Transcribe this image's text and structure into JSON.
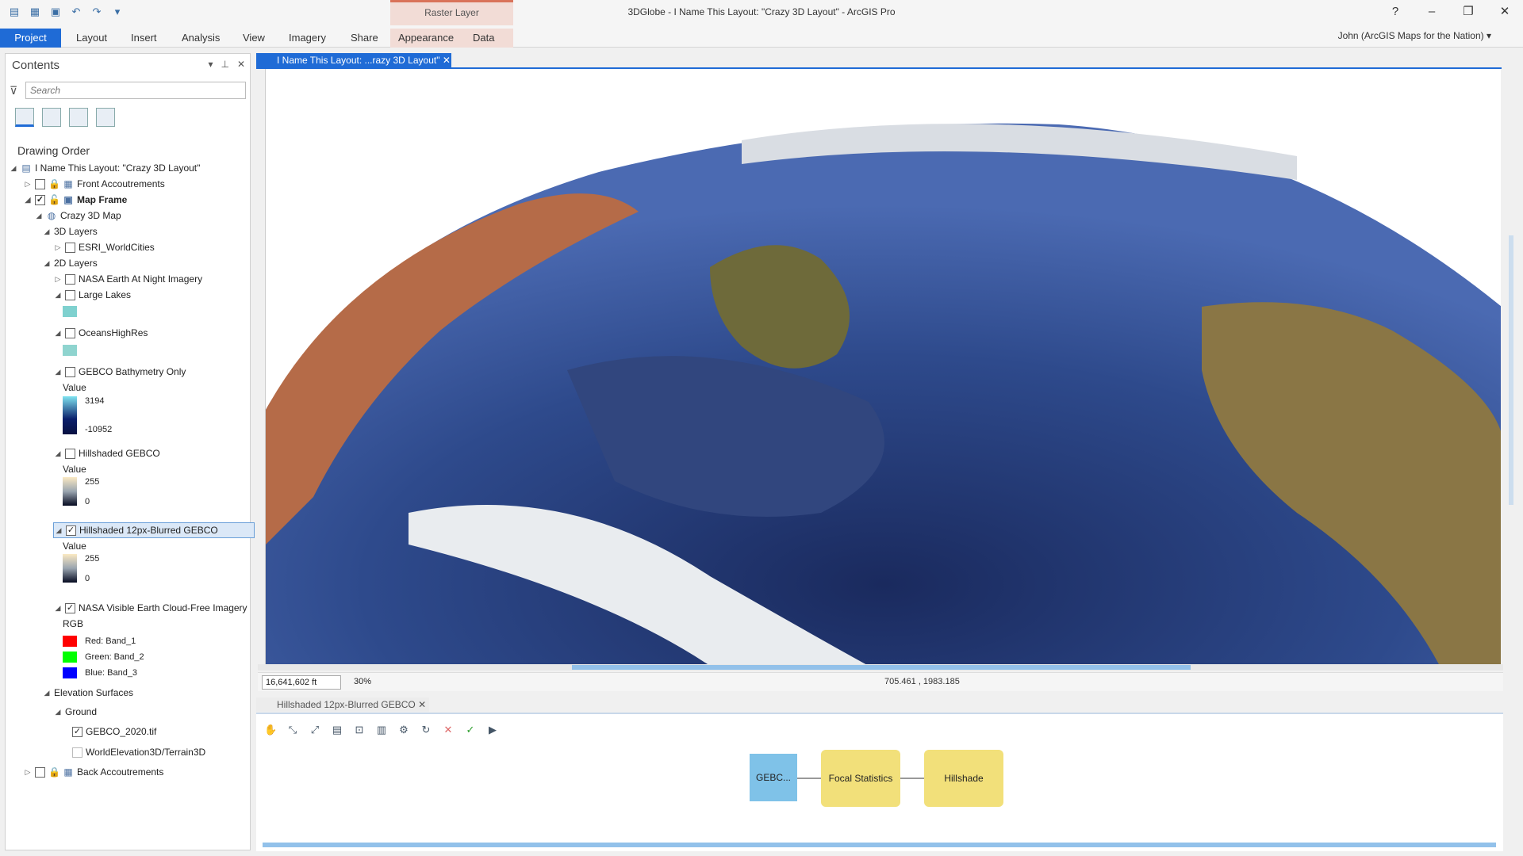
{
  "window": {
    "title": "3DGlobe - I Name This Layout: \"Crazy 3D Layout\" - ArcGIS Pro",
    "context_tab_group": "Raster Layer",
    "help": "?",
    "minimize": "–",
    "restore": "❐",
    "close": "✕"
  },
  "ribbon": {
    "tabs": [
      "Project",
      "Layout",
      "Insert",
      "Analysis",
      "View",
      "Imagery",
      "Share",
      "Appearance",
      "Data"
    ],
    "user": "John (ArcGIS Maps for the Nation) ▾"
  },
  "contents": {
    "title": "Contents",
    "search_placeholder": "Search",
    "drawing_order": "Drawing Order",
    "items": [
      {
        "label": "I Name This Layout: \"Crazy 3D Layout\""
      },
      {
        "label": "Front Accoutrements"
      },
      {
        "label": "Map Frame"
      },
      {
        "label": "Crazy 3D Map"
      },
      {
        "label": "3D Layers"
      },
      {
        "label": "ESRI_WorldCities"
      },
      {
        "label": "2D Layers"
      },
      {
        "label": "NASA Earth At Night Imagery"
      },
      {
        "label": "Large Lakes"
      },
      {
        "label": "OceansHighRes"
      },
      {
        "label": "GEBCO Bathymetry Only"
      },
      {
        "label": "Hillshaded GEBCO"
      },
      {
        "label": "Hillshaded 12px-Blurred GEBCO"
      },
      {
        "label": "NASA Visible Earth Cloud-Free Imagery"
      },
      {
        "label": "Elevation Surfaces"
      },
      {
        "label": "Ground"
      },
      {
        "label": "GEBCO_2020.tif"
      },
      {
        "label": "WorldElevation3D/Terrain3D"
      },
      {
        "label": "Back Accoutrements"
      }
    ],
    "legend": {
      "value_heading": "Value",
      "gebco_max": "3194",
      "gebco_min": "-10952",
      "hs_max": "255",
      "hs_min": "0",
      "hs12_max": "255",
      "hs12_min": "0",
      "rgb_heading": "RGB",
      "red": "Red:   Band_1",
      "green": "Green: Band_2",
      "blue": "Blue:  Band_3"
    },
    "colors": {
      "lake": "#7fd1cf",
      "ocean": "#8fd4cf",
      "red": "#ff0000",
      "green": "#00ff00",
      "blue": "#0000ff"
    }
  },
  "map_view": {
    "tab_label": "I Name This Layout: ...razy 3D Layout\"",
    "scale": "16,641,602 ft",
    "zoom": "30%",
    "coordinates": "705.461 , 1983.185"
  },
  "model_view": {
    "tab_label": "Hillshaded 12px-Blurred GEBCO",
    "nodes": [
      "GEBC...",
      "Focal Statistics",
      "Hillshade"
    ]
  }
}
